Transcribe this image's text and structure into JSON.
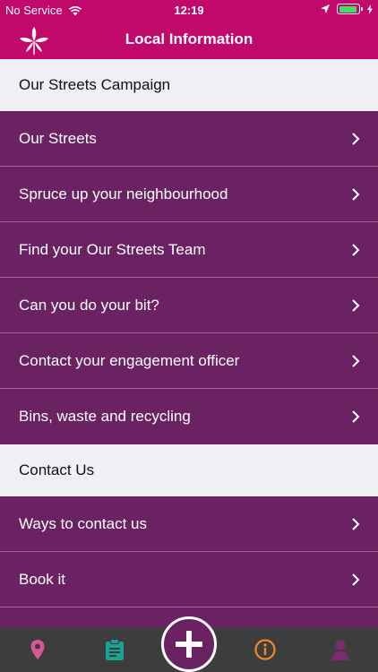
{
  "status_bar": {
    "carrier": "No Service",
    "time": "12:19",
    "battery_level": 0.95
  },
  "nav": {
    "title": "Local Information",
    "logo_icon": "leaf-icon"
  },
  "sections": [
    {
      "header": "Our Streets Campaign",
      "items": [
        "Our Streets",
        "Spruce up your neighbourhood",
        "Find your Our Streets Team",
        "Can you do your bit?",
        "Contact your engagement officer",
        "Bins, waste and recycling"
      ]
    },
    {
      "header": "Contact Us",
      "items": [
        "Ways to contact us",
        "Book it"
      ]
    }
  ],
  "tab_bar": {
    "tabs": [
      {
        "icon": "location-pin-icon",
        "color": "#d9569a"
      },
      {
        "icon": "clipboard-icon",
        "color": "#1aa592"
      },
      {
        "icon": "plus-icon",
        "color": "#ffffff"
      },
      {
        "icon": "info-icon",
        "color": "#f0882b"
      },
      {
        "icon": "person-icon",
        "color": "#7b2b6f"
      }
    ]
  },
  "colors": {
    "brand": "#c1096b",
    "row_background": "#6a2262",
    "section_background": "#efeff4",
    "tab_bar_background": "#3d3d3d"
  }
}
